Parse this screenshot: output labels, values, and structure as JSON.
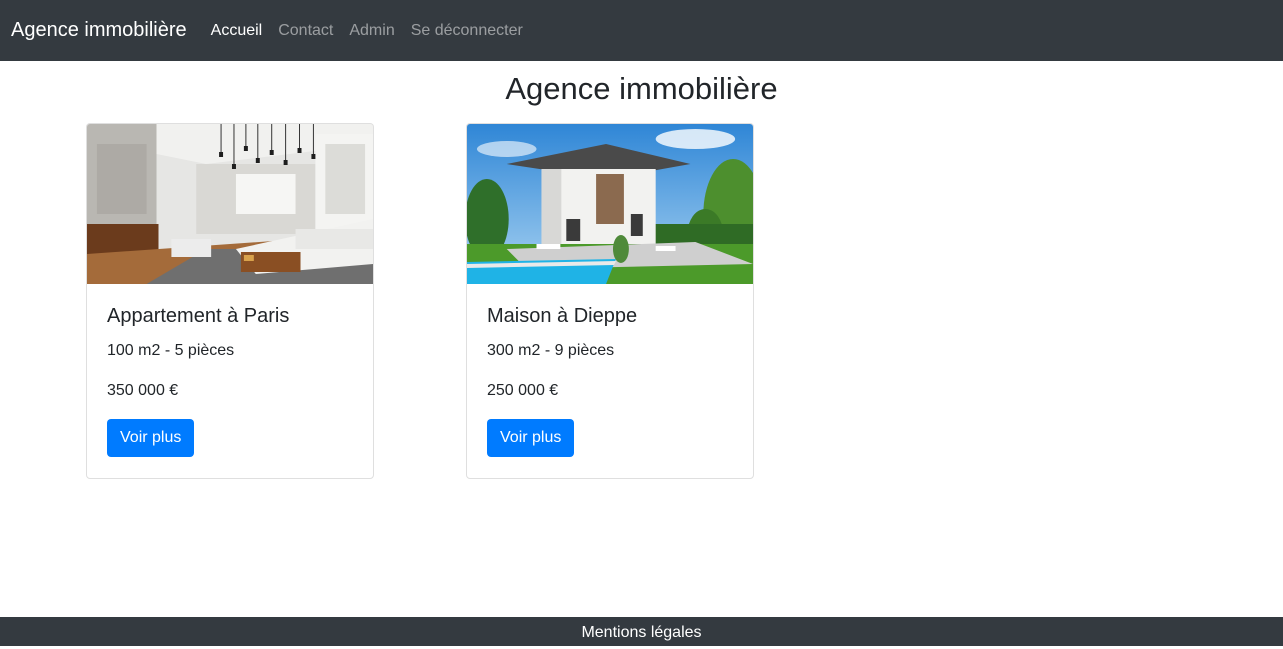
{
  "navbar": {
    "brand": "Agence immobilière",
    "links": [
      {
        "label": "Accueil",
        "active": true
      },
      {
        "label": "Contact"
      },
      {
        "label": "Admin"
      },
      {
        "label": "Se déconnecter"
      }
    ]
  },
  "main": {
    "title": "Agence immobilière",
    "listings": [
      {
        "title": "Appartement à Paris",
        "details": "100 m2 - 5 pièces",
        "price": "350 000 €",
        "button_label": "Voir plus"
      },
      {
        "title": "Maison à Dieppe",
        "details": "300 m2 - 9 pièces",
        "price": "250 000 €",
        "button_label": "Voir plus"
      }
    ]
  },
  "footer": {
    "link_label": "Mentions légales"
  },
  "colors": {
    "navbar_bg": "#343a40",
    "primary": "#007bff"
  }
}
